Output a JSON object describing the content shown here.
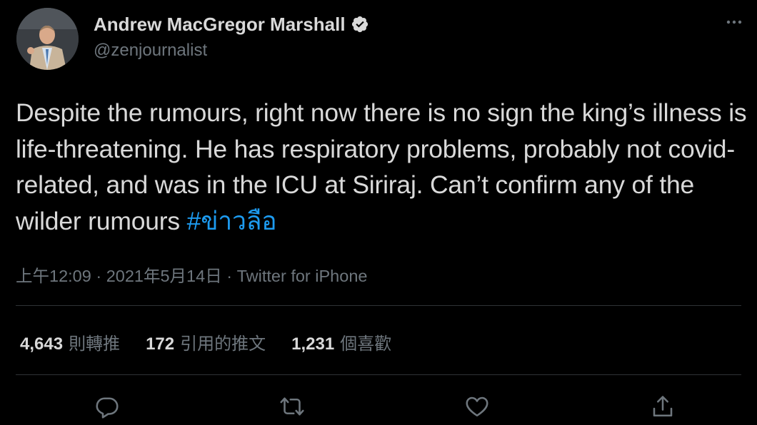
{
  "author": {
    "display_name": "Andrew MacGregor Marshall",
    "handle": "@zenjournalist",
    "verified": true
  },
  "tweet": {
    "text": "Despite the rumours, right now there is no sign the king’s illness is life-threatening. He has respiratory problems, probably not covid-related, and was in the ICU at Siriraj. Can’t confirm any of the wilder rumours ",
    "hashtag": "#ข่าวลือ"
  },
  "meta": {
    "time": "上午12:09",
    "separator1": " · ",
    "date": "2021年5月14日",
    "separator2": " · ",
    "source": "Twitter for iPhone"
  },
  "stats": {
    "retweets_count": "4,643",
    "retweets_label": "則轉推",
    "quotes_count": "172",
    "quotes_label": "引用的推文",
    "likes_count": "1,231",
    "likes_label": "個喜歡"
  },
  "icons": {
    "more": "more-icon",
    "verified": "verified-badge-icon",
    "reply": "reply-icon",
    "retweet": "retweet-icon",
    "like": "heart-icon",
    "share": "share-icon"
  },
  "colors": {
    "background": "#000000",
    "text": "#d9d9d9",
    "secondary": "#6e767d",
    "link": "#1d9bf0",
    "divider": "#2f3336"
  }
}
